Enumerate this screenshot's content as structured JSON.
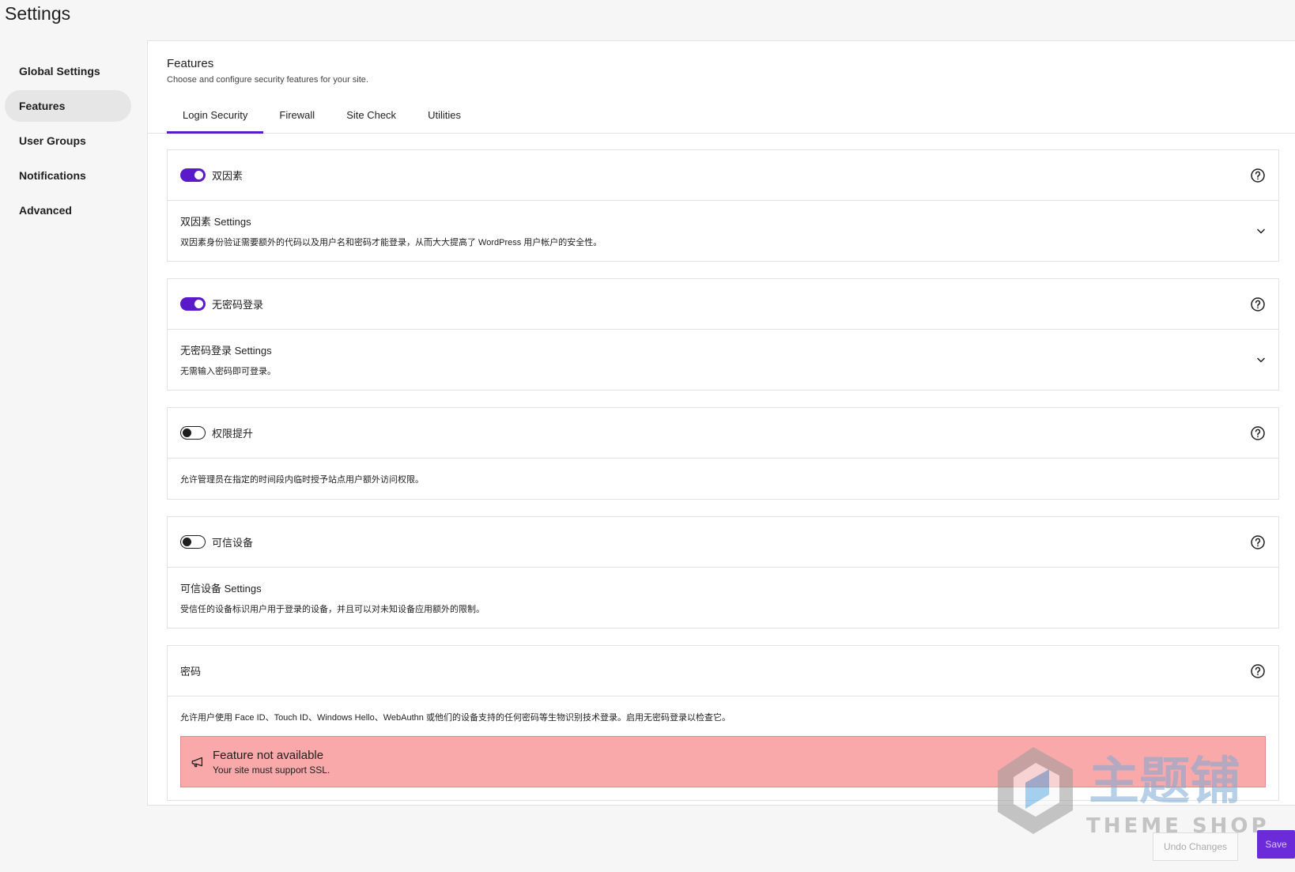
{
  "page": {
    "title": "Settings"
  },
  "sidebar": {
    "items": [
      {
        "label": "Global Settings",
        "active": false
      },
      {
        "label": "Features",
        "active": true
      },
      {
        "label": "User Groups",
        "active": false
      },
      {
        "label": "Notifications",
        "active": false
      },
      {
        "label": "Advanced",
        "active": false
      }
    ]
  },
  "main": {
    "title": "Features",
    "description": "Choose and configure security features for your site.",
    "tabs": [
      {
        "label": "Login Security",
        "active": true
      },
      {
        "label": "Firewall",
        "active": false
      },
      {
        "label": "Site Check",
        "active": false
      },
      {
        "label": "Utilities",
        "active": false
      }
    ]
  },
  "cards": [
    {
      "label": "双因素",
      "enabled": true,
      "settings_title": "双因素 Settings",
      "description": "双因素身份验证需要额外的代码以及用户名和密码才能登录，从而大大提高了 WordPress 用户帐户的安全性。"
    },
    {
      "label": "无密码登录",
      "enabled": true,
      "settings_title": "无密码登录 Settings",
      "description": "无需输入密码即可登录。"
    },
    {
      "label": "权限提升",
      "enabled": false,
      "description": "允许管理员在指定的时间段内临时授予站点用户额外访问权限。"
    },
    {
      "label": "可信设备",
      "enabled": false,
      "settings_title": "可信设备 Settings",
      "description": "受信任的设备标识用户用于登录的设备，并且可以对未知设备应用额外的限制。"
    },
    {
      "label": "密码",
      "description": "允许用户使用 Face ID、Touch ID、Windows Hello、WebAuthn 或他们的设备支持的任何密码等生物识别技术登录。启用无密码登录以检查它。",
      "notice": {
        "title": "Feature not available",
        "text": "Your site must support SSL."
      }
    }
  ],
  "footer": {
    "undo_label": "Undo Changes",
    "save_label": "Save"
  },
  "watermark": {
    "brand_cn": "主题铺",
    "brand_en": "THEME SHOP"
  },
  "colors": {
    "accent": "#5a1ac9",
    "notice_bg": "#f9a9a9",
    "save_bg": "#6c2bd9"
  }
}
